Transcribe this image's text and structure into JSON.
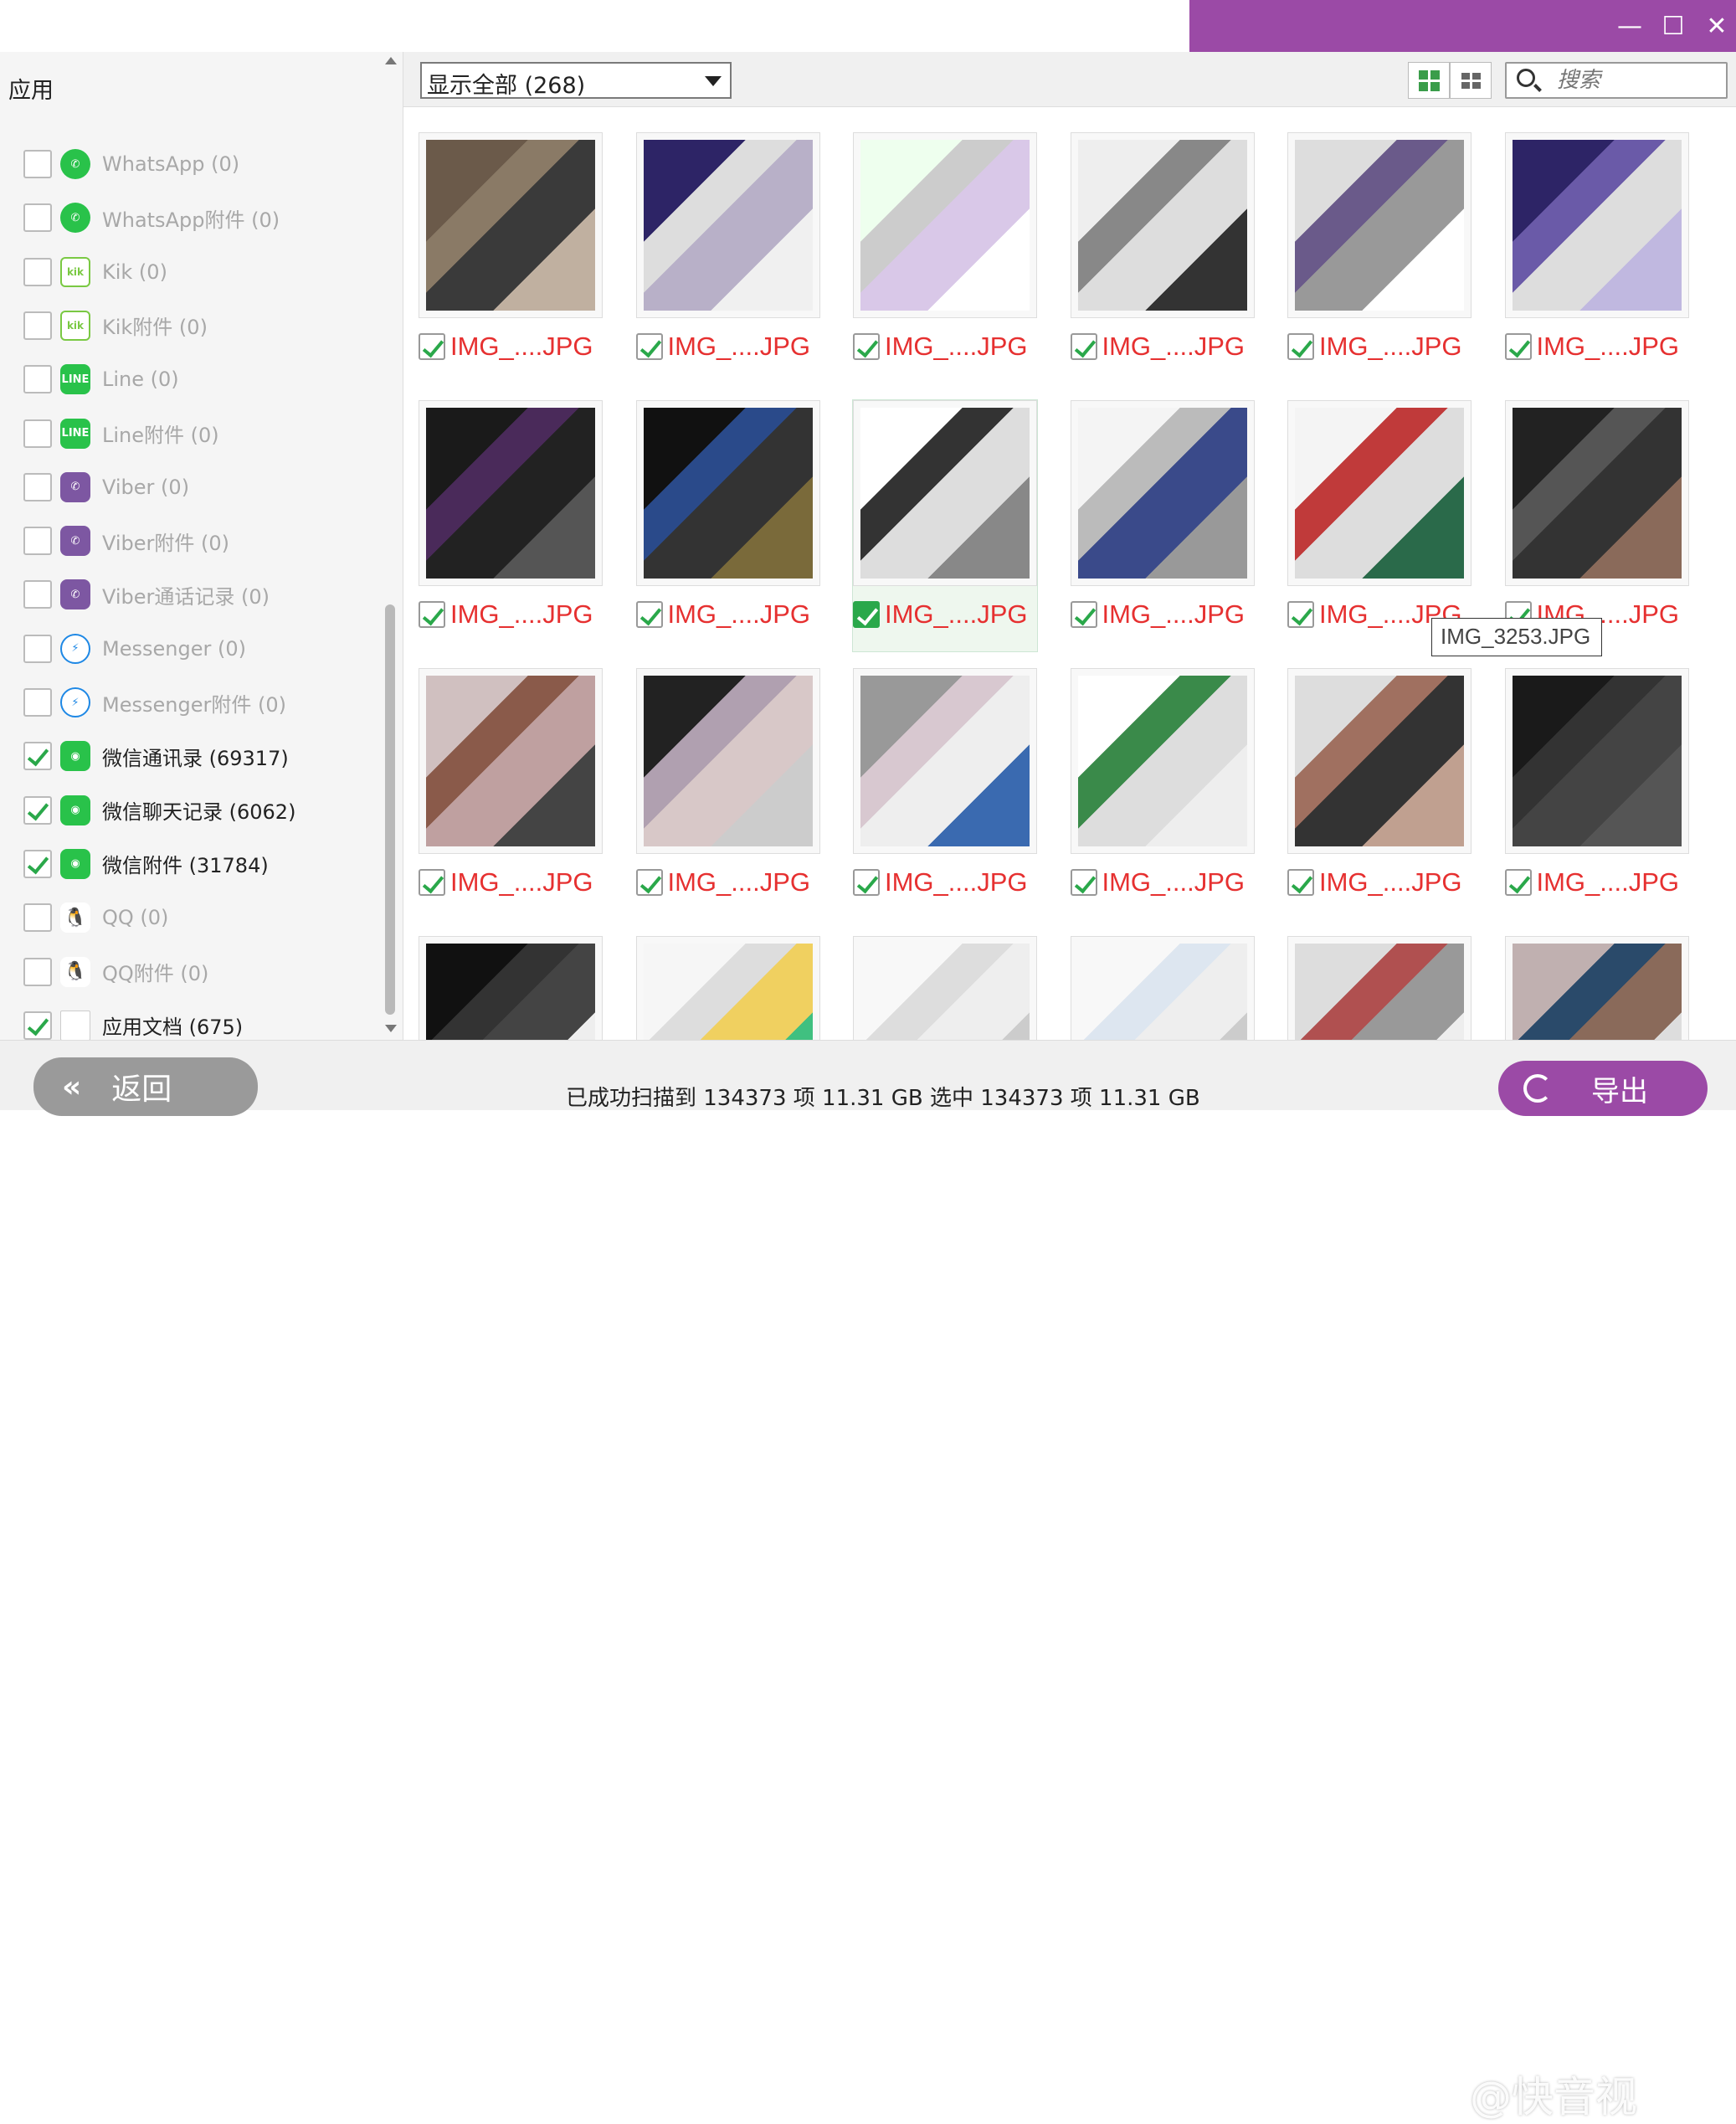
{
  "window": {
    "minimize": "—",
    "maximize": "☐",
    "close": "✕"
  },
  "sidebar": {
    "title": "应用",
    "items": [
      {
        "label": "WhatsApp (0)",
        "icon": "whatsapp-icon",
        "checked": false
      },
      {
        "label": "WhatsApp附件 (0)",
        "icon": "whatsapp-icon",
        "checked": false
      },
      {
        "label": "Kik (0)",
        "icon": "kik-icon",
        "checked": false
      },
      {
        "label": "Kik附件 (0)",
        "icon": "kik-icon",
        "checked": false
      },
      {
        "label": "Line (0)",
        "icon": "line-icon",
        "checked": false
      },
      {
        "label": "Line附件 (0)",
        "icon": "line-icon",
        "checked": false
      },
      {
        "label": "Viber (0)",
        "icon": "viber-icon",
        "checked": false
      },
      {
        "label": "Viber附件 (0)",
        "icon": "viber-icon",
        "checked": false
      },
      {
        "label": "Viber通话记录 (0)",
        "icon": "viber-icon",
        "checked": false
      },
      {
        "label": "Messenger (0)",
        "icon": "messenger-icon",
        "checked": false
      },
      {
        "label": "Messenger附件 (0)",
        "icon": "messenger-icon",
        "checked": false
      },
      {
        "label": "微信通讯录 (69317)",
        "icon": "wechat-icon",
        "checked": true
      },
      {
        "label": "微信聊天记录 (6062)",
        "icon": "wechat-icon",
        "checked": true
      },
      {
        "label": "微信附件 (31784)",
        "icon": "wechat-icon",
        "checked": true
      },
      {
        "label": "QQ (0)",
        "icon": "qq-icon",
        "checked": false
      },
      {
        "label": "QQ附件 (0)",
        "icon": "qq-icon",
        "checked": false
      },
      {
        "label": "应用文档 (675)",
        "icon": "document-icon",
        "checked": true
      }
    ]
  },
  "toolbar": {
    "filter_label": "显示全部 (268)",
    "search_placeholder": "搜索"
  },
  "files": {
    "caption": "IMG_....JPG",
    "tooltip": "IMG_3253.JPG"
  },
  "footer": {
    "back_label": "返回",
    "back_chevron": "«",
    "status": "已成功扫描到 134373 项 11.31 GB  选中 134373 项 11.31 GB",
    "export_label": "导出",
    "watermark": "@快音视"
  },
  "colors": {
    "accent": "#9b4aa6",
    "check": "#2aa84a",
    "filename": "#e63030"
  }
}
